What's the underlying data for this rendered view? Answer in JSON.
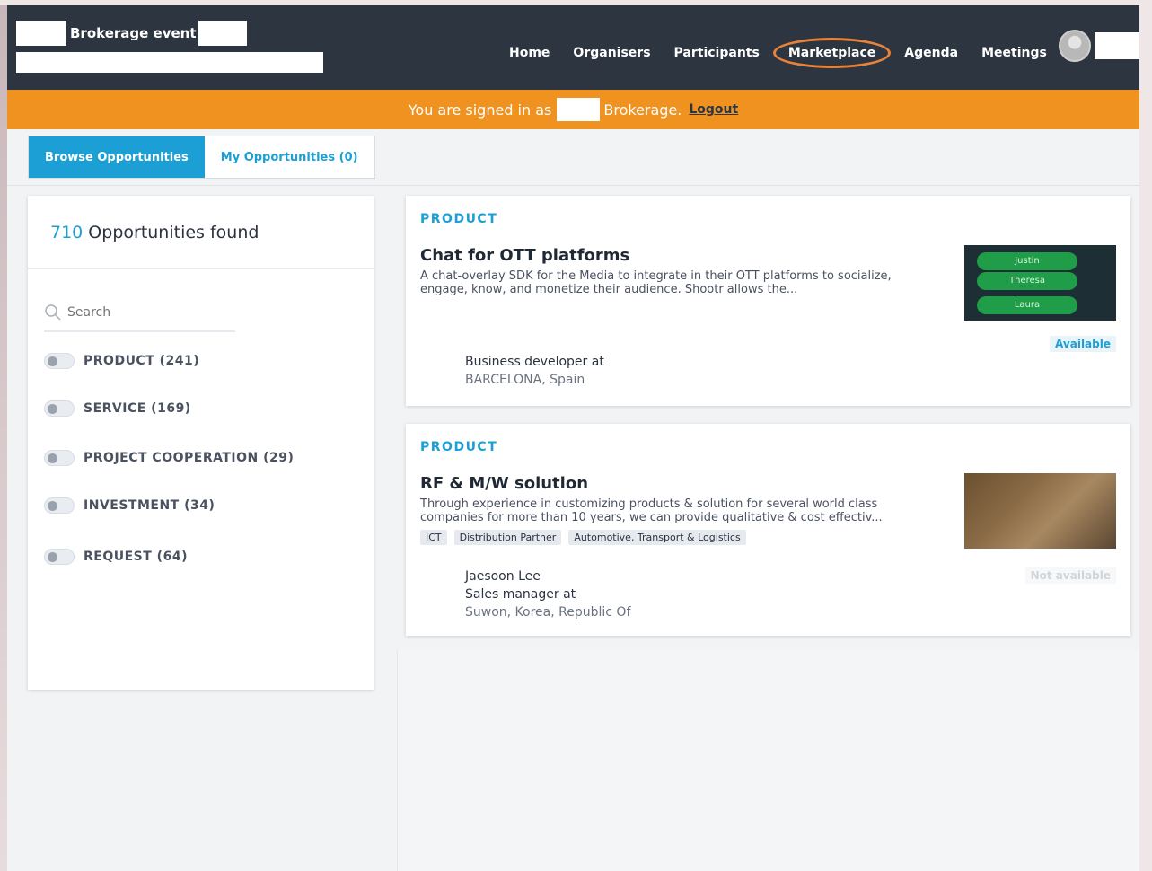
{
  "header": {
    "event_title": "Brokerage event",
    "nav": [
      {
        "label": "Home"
      },
      {
        "label": "Organisers"
      },
      {
        "label": "Participants"
      },
      {
        "label": "Marketplace",
        "active": true
      },
      {
        "label": "Agenda"
      },
      {
        "label": "Meetings"
      }
    ]
  },
  "banner": {
    "prefix": "You are signed in as",
    "suffix": "Brokerage.",
    "logout": "Logout"
  },
  "tabs": {
    "browse": "Browse Opportunities",
    "mine": "My Opportunities (0)"
  },
  "sidebar": {
    "count": "710",
    "count_label": " Opportunities found",
    "search_placeholder": "Search",
    "filters": [
      {
        "label": "PRODUCT (241)"
      },
      {
        "label": "SERVICE (169)"
      },
      {
        "label": "PROJECT COOPERATION (29)"
      },
      {
        "label": "INVESTMENT (34)"
      },
      {
        "label": "REQUEST (64)"
      }
    ]
  },
  "opportunities": [
    {
      "type": "PRODUCT",
      "title": "Chat for OTT platforms",
      "description": "A chat-overlay SDK for the Media to integrate in their OTT platforms to socialize, engage, know, and monetize their audience. Shootr allows the...",
      "thumb_pills": [
        "Justin",
        "Theresa",
        "Laura"
      ],
      "availability": "Available",
      "person_role": "Business developer at",
      "person_location": "BARCELONA, Spain"
    },
    {
      "type": "PRODUCT",
      "title": "RF & M/W solution",
      "description": "Through experience in customizing products & solution for several world class companies for more than 10 years, we can provide qualitative & cost effectiv...",
      "tags": [
        "ICT",
        "Distribution Partner",
        "Automotive, Transport & Logistics"
      ],
      "availability": "Not available",
      "person_name": "Jaesoon Lee",
      "person_role": "Sales manager at",
      "person_location": "Suwon, Korea, Republic Of"
    }
  ],
  "colors": {
    "header_bg": "#2d3540",
    "banner_bg": "#f0921f",
    "accent": "#1b9fd5",
    "highlight_circle": "#e8823a"
  }
}
